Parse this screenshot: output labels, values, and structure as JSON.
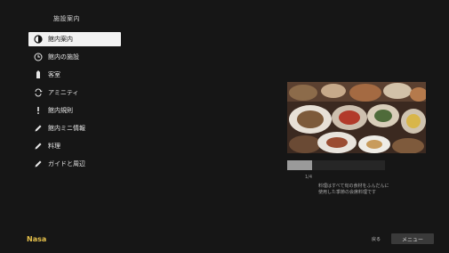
{
  "header": {
    "title": "施設案内"
  },
  "menu": {
    "items": [
      {
        "label": "館内案内",
        "icon": "contrast-icon",
        "selected": true
      },
      {
        "label": "館内の施設",
        "icon": "clock-icon",
        "selected": false
      },
      {
        "label": "客室",
        "icon": "battery-icon",
        "selected": false
      },
      {
        "label": "アミニティ",
        "icon": "sync-icon",
        "selected": false
      },
      {
        "label": "館内規則",
        "icon": "exclamation-icon",
        "selected": false
      },
      {
        "label": "館内ミニ情報",
        "icon": "pen-icon",
        "selected": false
      },
      {
        "label": "料理",
        "icon": "pen-icon",
        "selected": false
      },
      {
        "label": "ガイドと周辺",
        "icon": "pen-icon",
        "selected": false
      }
    ]
  },
  "preview": {
    "progress_fraction": 0.25,
    "caption": "1/4",
    "description_lines": [
      "料理はすべて旬の食材をふんだんに",
      "使用した季節の会席料理です"
    ]
  },
  "footer": {
    "logo_text": "Nasa",
    "page_label": "戻る",
    "button_label": "メニュー"
  },
  "colors": {
    "background": "#161616",
    "selected_bg": "#f2f2f2",
    "logo": "#e5c04b",
    "progress_fill": "#9a9a9a"
  }
}
